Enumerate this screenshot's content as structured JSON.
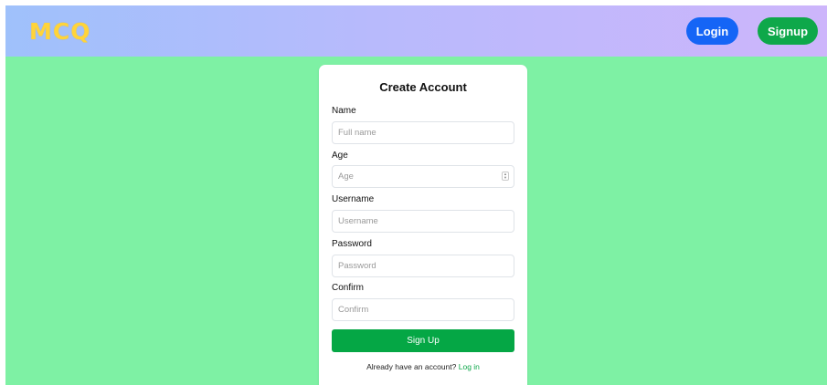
{
  "header": {
    "logo": "MCQ",
    "login_label": "Login",
    "signup_label": "Signup"
  },
  "form": {
    "title": "Create Account",
    "fields": [
      {
        "label": "Name",
        "placeholder": "Full name"
      },
      {
        "label": "Age",
        "placeholder": "Age"
      },
      {
        "label": "Username",
        "placeholder": "Username"
      },
      {
        "label": "Password",
        "placeholder": "Password"
      },
      {
        "label": "Confirm",
        "placeholder": "Confirm"
      }
    ],
    "submit_label": "Sign Up",
    "footer_text": "Already have an account?",
    "footer_link": "Log in"
  },
  "colors": {
    "page_bg": "#7ef1a4",
    "login_button": "#1565f6",
    "signup_button": "#0ea84a",
    "submit_button": "#05a745",
    "logo": "#ffd43a"
  },
  "icons": {
    "age_stepper": "number-stepper-icon"
  }
}
